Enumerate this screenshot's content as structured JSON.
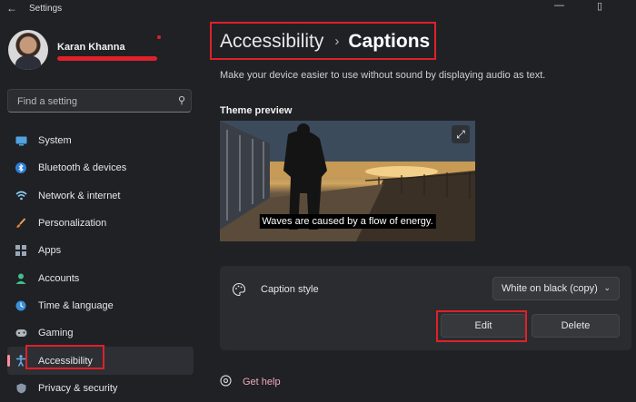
{
  "titlebar": {
    "back_icon": "back-arrow-icon",
    "title": "Settings"
  },
  "profile": {
    "name": "Karan Khanna"
  },
  "search": {
    "placeholder": "Find a setting"
  },
  "nav": {
    "items": [
      {
        "label": "System",
        "icon": "monitor-icon"
      },
      {
        "label": "Bluetooth & devices",
        "icon": "bluetooth-icon"
      },
      {
        "label": "Network & internet",
        "icon": "wifi-icon"
      },
      {
        "label": "Personalization",
        "icon": "brush-icon"
      },
      {
        "label": "Apps",
        "icon": "apps-icon"
      },
      {
        "label": "Accounts",
        "icon": "person-icon"
      },
      {
        "label": "Time & language",
        "icon": "globe-clock-icon"
      },
      {
        "label": "Gaming",
        "icon": "gamepad-icon"
      },
      {
        "label": "Accessibility",
        "icon": "accessibility-icon",
        "active": true
      },
      {
        "label": "Privacy & security",
        "icon": "shield-icon"
      }
    ]
  },
  "breadcrumb": {
    "parent": "Accessibility",
    "separator": "›",
    "current": "Captions"
  },
  "description": "Make your device easier to use without sound by displaying audio as text.",
  "preview": {
    "label": "Theme preview",
    "caption": "Waves are caused by a flow of energy."
  },
  "caption_style": {
    "label": "Caption style",
    "selected": "White on black (copy)",
    "edit_label": "Edit",
    "delete_label": "Delete"
  },
  "help": {
    "label": "Get help"
  },
  "colors": {
    "accent": "#64b5f6",
    "highlight": "#e0202a",
    "link": "#f2a8bb",
    "indicator": "#ff8da0"
  }
}
